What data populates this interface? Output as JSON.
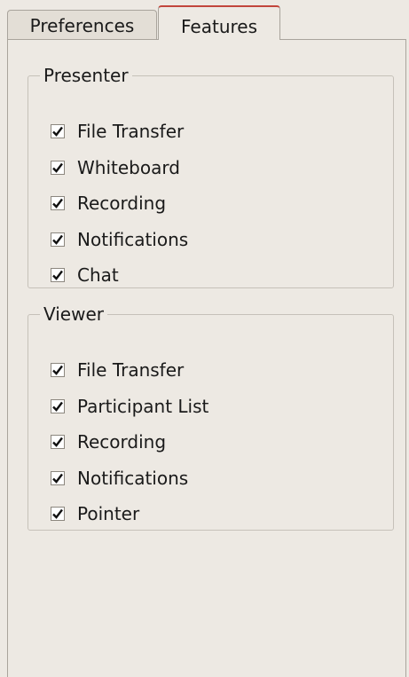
{
  "tabs": [
    {
      "label": "Preferences",
      "active": false
    },
    {
      "label": "Features",
      "active": true
    }
  ],
  "presenter": {
    "title": "Presenter",
    "items": [
      {
        "label": "File Transfer",
        "checked": true
      },
      {
        "label": "Whiteboard",
        "checked": true
      },
      {
        "label": "Recording",
        "checked": true
      },
      {
        "label": "Notifications",
        "checked": true
      },
      {
        "label": "Chat",
        "checked": true
      }
    ]
  },
  "viewer": {
    "title": "Viewer",
    "items": [
      {
        "label": "File Transfer",
        "checked": true
      },
      {
        "label": "Participant List",
        "checked": true
      },
      {
        "label": "Recording",
        "checked": true
      },
      {
        "label": "Notifications",
        "checked": true
      },
      {
        "label": "Pointer",
        "checked": true
      }
    ]
  },
  "colors": {
    "background": "#ede9e3",
    "active_tab_accent": "#c2463c",
    "border": "#a9a49c"
  },
  "icons": {
    "checkbox_mark": "checkmark-icon"
  }
}
